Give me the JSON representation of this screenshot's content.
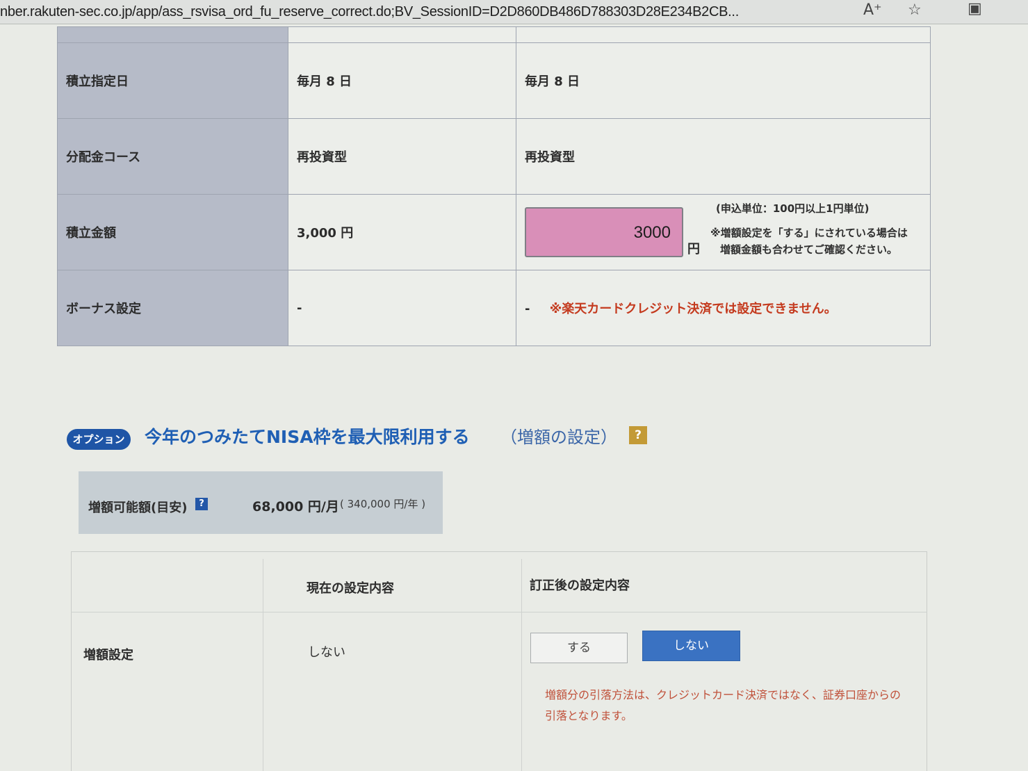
{
  "browser": {
    "url": "nber.rakuten-sec.co.jp/app/ass_rsvisa_ord_fu_reserve_correct.do;BV_SessionID=D2D860DB486D788303D28E234B2CB...",
    "read_aloud_icon": "A⁺",
    "favorite_icon": "☆"
  },
  "top_table": {
    "rows": [
      {
        "label": "積立指定日",
        "current": "毎月 8 日",
        "corrected": "毎月 8 日"
      },
      {
        "label": "分配金コース",
        "current": "再投資型",
        "corrected": "再投資型"
      },
      {
        "label": "積立金額",
        "current": "3,000 円",
        "input_value": "3000",
        "unit": "円",
        "unit_note": "(申込単位：100円以上1円単位)",
        "increase_note_1": "※増額設定を「する」にされている場合は",
        "increase_note_2": "増額金額も合わせてご確認ください。"
      },
      {
        "label": "ボーナス設定",
        "current": "-",
        "corrected": "-",
        "note": "※楽天カードクレジット決済では設定できません。"
      }
    ]
  },
  "option": {
    "badge": "オプション",
    "title": "今年のつみたてNISA枠を最大限利用する",
    "subtitle": "（増額の設定）",
    "help": "?"
  },
  "increase": {
    "label": "増額可能額(目安)",
    "help": "?",
    "monthly": "68,000 円/月",
    "yearly": "( 340,000 円/年 )"
  },
  "bottom_table": {
    "header_current": "現在の設定内容",
    "header_corrected": "訂正後の設定内容",
    "row_label": "増額設定",
    "current_value": "しない",
    "btn_yes": "する",
    "btn_no": "しない",
    "selected": "しない",
    "note": "増額分の引落方法は、クレジットカード決済ではなく、証券口座からの引落となります。"
  },
  "colors": {
    "amount_input_bg": "#d98fb8",
    "selected_button": "#3a72c2",
    "warning_red": "#c43a1e",
    "option_blue": "#1f55a6"
  }
}
